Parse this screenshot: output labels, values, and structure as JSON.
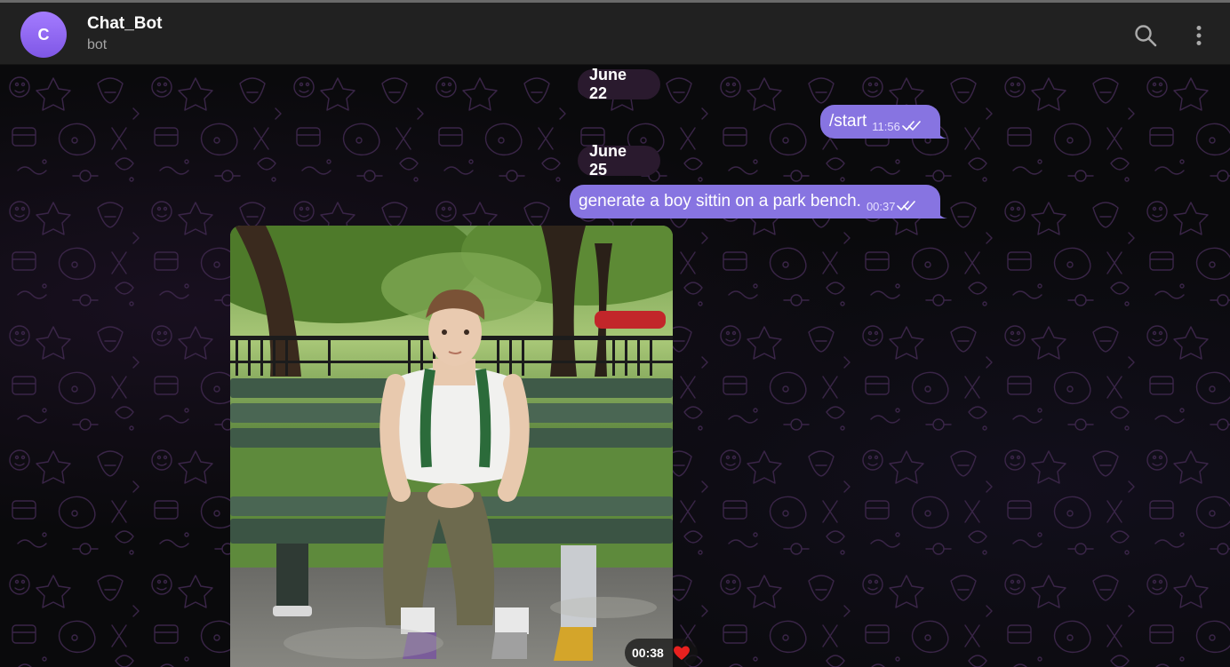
{
  "header": {
    "avatar_letter": "C",
    "title": "Chat_Bot",
    "status": "bot",
    "search_icon": "search-icon",
    "more_icon": "more-vertical-icon"
  },
  "messages": {
    "date1": "June 22",
    "date2": "June 25",
    "msg1": {
      "text": "/start",
      "time": "11:56",
      "status_icon": "double-check-icon"
    },
    "msg2": {
      "text": "generate a boy sittin on a park bench.",
      "time": "00:37",
      "status_icon": "double-check-icon"
    },
    "photo": {
      "time": "00:38",
      "reaction": "heart-icon"
    }
  },
  "colors": {
    "accent_bubble": "#8774e1",
    "avatar": "#8b64f0",
    "header_bg": "#212121",
    "date_pill": "#2a1a2e",
    "reaction_heart": "#e8211f"
  }
}
